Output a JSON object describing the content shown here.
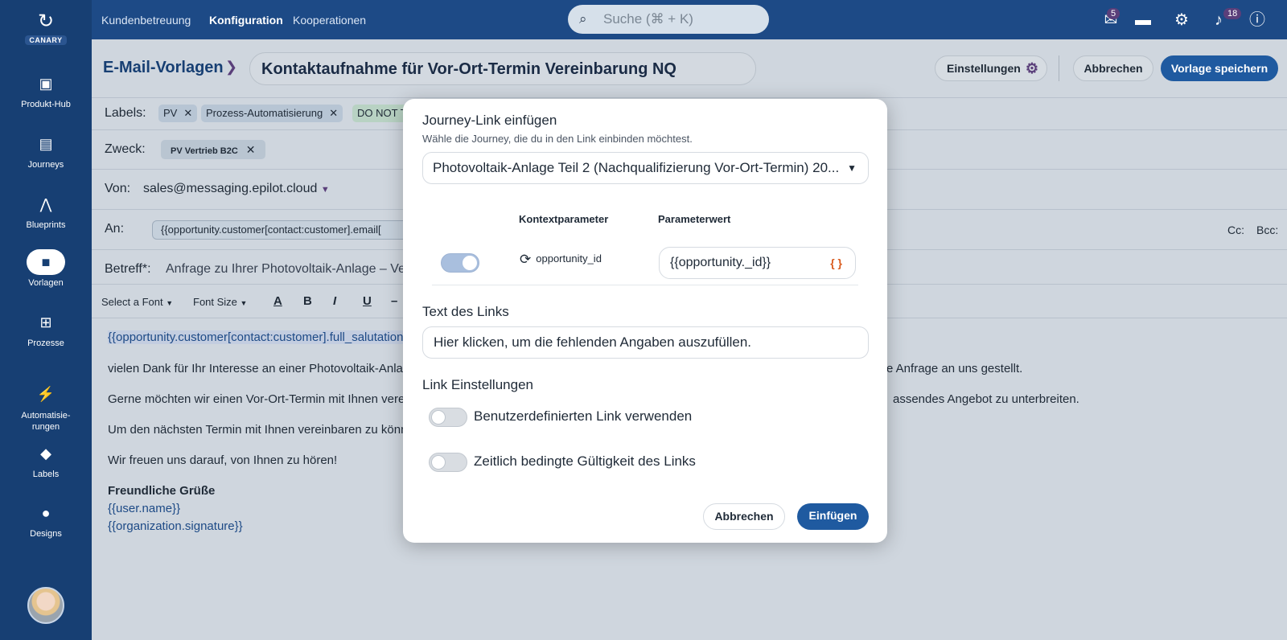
{
  "sidebar": {
    "logo_text": "CANARY",
    "items": [
      {
        "label": "Produkt-Hub",
        "icon": "box-icon"
      },
      {
        "label": "Journeys",
        "icon": "browser-icon"
      },
      {
        "label": "Blueprints",
        "icon": "compass-icon"
      },
      {
        "label": "Vorlagen",
        "icon": "folder-icon"
      },
      {
        "label": "Prozesse",
        "icon": "flow-icon"
      },
      {
        "label": "Automatisie-\nrungen",
        "icon": "bolt-icon"
      },
      {
        "label": "Labels",
        "icon": "tag-icon"
      },
      {
        "label": "Designs",
        "icon": "palette-icon"
      }
    ]
  },
  "topbar": {
    "nav": [
      "Kundenbetreuung",
      "Konfiguration",
      "Kooperationen"
    ],
    "search_placeholder": "Suche (⌘ + K)",
    "mail_count": "5",
    "notification_count": "18"
  },
  "header": {
    "breadcrumb": "E-Mail-Vorlagen",
    "template_title": "Kontaktaufnahme für Vor-Ort-Termin Vereinbarung NQ",
    "settings_label": "Einstellungen",
    "cancel_label": "Abbrechen",
    "save_label": "Vorlage speichern"
  },
  "form": {
    "labels_label": "Labels:",
    "labels": [
      "PV",
      "Prozess-Automatisierung",
      "DO NOT T"
    ],
    "purpose_label": "Zweck:",
    "purpose_tag": "PV Vertrieb B2C",
    "from_label": "Von:",
    "from_value": "sales@messaging.epilot.cloud",
    "to_label": "An:",
    "to_value": "{{opportunity.customer[contact:customer].email[",
    "cc_label": "Cc:",
    "bcc_label": "Bcc:",
    "subject_label": "Betreff*:",
    "subject_value": "Anfrage zu Ihrer Photovoltaik-Anlage – Ve"
  },
  "editor_toolbar": {
    "font": "Select a Font",
    "font_size": "Font Size"
  },
  "email_body": {
    "salutation": "{{opportunity.customer[contact:customer].full_salutation}}",
    "line1_left": "vielen Dank für Ihr Interesse an einer Photovoltaik-Anlag",
    "line1_right": "e Anfrage an uns gestellt.",
    "line2_left": "Gerne möchten wir einen Vor-Ort-Termin mit Ihnen verei",
    "line2_right": "assendes Angebot zu unterbreiten.",
    "line3_left": "Um den nächsten Termin mit Ihnen vereinbaren zu könn",
    "line4": "Wir freuen uns darauf, von Ihnen zu hören!",
    "closing": "Freundliche Grüße",
    "user_var": "{{user.name}}",
    "signature_var": "{{organization.signature}}"
  },
  "modal": {
    "title": "Journey-Link einfügen",
    "subtitle": "Wähle die Journey, die du in den Link einbinden möchtest.",
    "journey_selected": "Photovoltaik-Anlage Teil 2 (Nachqualifizierung Vor-Ort-Termin) 20...",
    "col_param": "Kontextparameter",
    "col_value": "Parameterwert",
    "param_name": "opportunity_id",
    "param_value": "{{opportunity._id}}",
    "param_enabled": true,
    "link_text_label": "Text des Links",
    "link_text_value": "Hier klicken, um die fehlenden Angaben auszufüllen.",
    "link_settings_label": "Link Einstellungen",
    "custom_link_label": "Benutzerdefinierten Link verwenden",
    "custom_link_enabled": false,
    "time_validity_label": "Zeitlich bedingte Gültigkeit des Links",
    "time_validity_enabled": false,
    "cancel_label": "Abbrechen",
    "insert_label": "Einfügen"
  },
  "colors": {
    "sidebar_bg": "#173f73",
    "primary": "#1f5aa0",
    "accent_purple": "#5a3f7a"
  }
}
